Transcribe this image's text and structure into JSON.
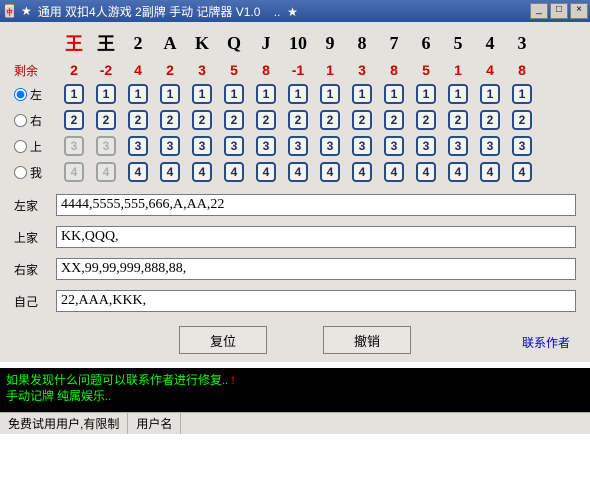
{
  "title": "通用 双扣4人游戏 2副牌 手动 记牌器 V1.0",
  "title_dots": "..",
  "stars": "★",
  "header_cards": [
    {
      "label": "王",
      "red": true
    },
    {
      "label": "王",
      "red": false
    },
    {
      "label": "2",
      "red": false
    },
    {
      "label": "A",
      "red": false
    },
    {
      "label": "K",
      "red": false
    },
    {
      "label": "Q",
      "red": false
    },
    {
      "label": "J",
      "red": false
    },
    {
      "label": "10",
      "red": false
    },
    {
      "label": "9",
      "red": false
    },
    {
      "label": "8",
      "red": false
    },
    {
      "label": "7",
      "red": false
    },
    {
      "label": "6",
      "red": false
    },
    {
      "label": "5",
      "red": false
    },
    {
      "label": "4",
      "red": false
    },
    {
      "label": "3",
      "red": false
    }
  ],
  "remain_label": "剩余",
  "remain": [
    "2",
    "-2",
    "4",
    "2",
    "3",
    "5",
    "8",
    "-1",
    "1",
    "3",
    "8",
    "5",
    "1",
    "4",
    "8"
  ],
  "rows": [
    {
      "label": "左",
      "checked": true,
      "vals": [
        1,
        1,
        1,
        1,
        1,
        1,
        1,
        1,
        1,
        1,
        1,
        1,
        1,
        1,
        1
      ],
      "disabled": []
    },
    {
      "label": "右",
      "checked": false,
      "vals": [
        2,
        2,
        2,
        2,
        2,
        2,
        2,
        2,
        2,
        2,
        2,
        2,
        2,
        2,
        2
      ],
      "disabled": []
    },
    {
      "label": "上",
      "checked": false,
      "vals": [
        3,
        3,
        3,
        3,
        3,
        3,
        3,
        3,
        3,
        3,
        3,
        3,
        3,
        3,
        3
      ],
      "disabled": [
        0,
        1
      ]
    },
    {
      "label": "我",
      "checked": false,
      "vals": [
        4,
        4,
        4,
        4,
        4,
        4,
        4,
        4,
        4,
        4,
        4,
        4,
        4,
        4,
        4
      ],
      "disabled": [
        0,
        1
      ]
    }
  ],
  "players": [
    {
      "label": "左家",
      "value": "4444,5555,555,666,A,AA,22"
    },
    {
      "label": "上家",
      "value": "KK,QQQ,"
    },
    {
      "label": "右家",
      "value": "XX,99,99,999,888,88,"
    },
    {
      "label": "自己",
      "value": "22,AAA,KKK,"
    }
  ],
  "buttons": {
    "reset": "复位",
    "undo": "撤销",
    "contact": "联系作者"
  },
  "console": {
    "line1": "如果发现什么问题可以联系作者进行修复.. ",
    "excl": "!",
    "line2": "手动记牌 纯属娱乐.."
  },
  "status": {
    "trial": "免费试用用户,有限制",
    "username_label": "用户名"
  }
}
